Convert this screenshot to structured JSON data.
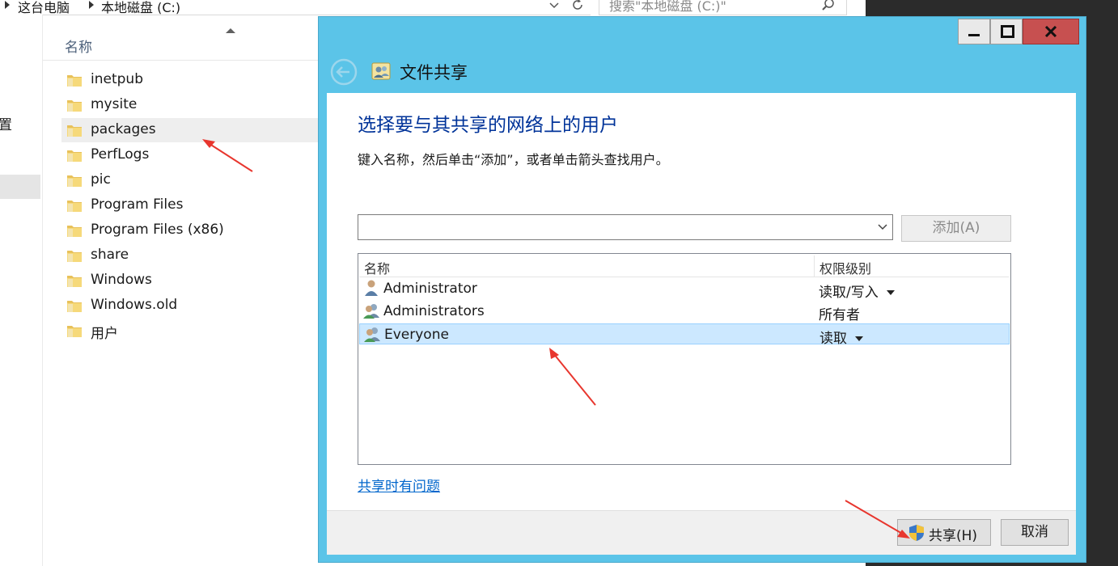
{
  "explorer": {
    "breadcrumb": [
      "这台电脑",
      "本地磁盘 (C:)"
    ],
    "search_placeholder": "搜索\"本地磁盘 (C:)\"",
    "column_name": "名称",
    "nav_partial_label": "置",
    "folders": [
      {
        "name": "inetpub"
      },
      {
        "name": "mysite"
      },
      {
        "name": "packages",
        "selected": true
      },
      {
        "name": "PerfLogs"
      },
      {
        "name": "pic"
      },
      {
        "name": "Program Files"
      },
      {
        "name": "Program Files (x86)"
      },
      {
        "name": "share"
      },
      {
        "name": "Windows"
      },
      {
        "name": "Windows.old"
      },
      {
        "name": "用户"
      }
    ]
  },
  "dialog": {
    "title": "文件共享",
    "heading": "选择要与其共享的网络上的用户",
    "instruction": "键入名称，然后单击“添加”，或者单击箭头查找用户。",
    "name_input_value": "",
    "add_button": "添加(A)",
    "columns": {
      "name": "名称",
      "permission": "权限级别"
    },
    "users": [
      {
        "name": "Administrator",
        "permission": "读取/写入",
        "dropdown": true,
        "icon": "user-icon"
      },
      {
        "name": "Administrators",
        "permission": "所有者",
        "dropdown": false,
        "icon": "group-icon"
      },
      {
        "name": "Everyone",
        "permission": "读取",
        "dropdown": true,
        "icon": "group-icon",
        "selected": true
      }
    ],
    "help_link": "共享时有问题",
    "share_button": "共享(H)",
    "cancel_button": "取消"
  },
  "colors": {
    "dialog_frame": "#5bc4e8",
    "heading": "#003399",
    "link": "#0066cc",
    "close_button": "#c75050",
    "annotation_arrow": "#e8362e",
    "selection": "#cce8ff"
  }
}
